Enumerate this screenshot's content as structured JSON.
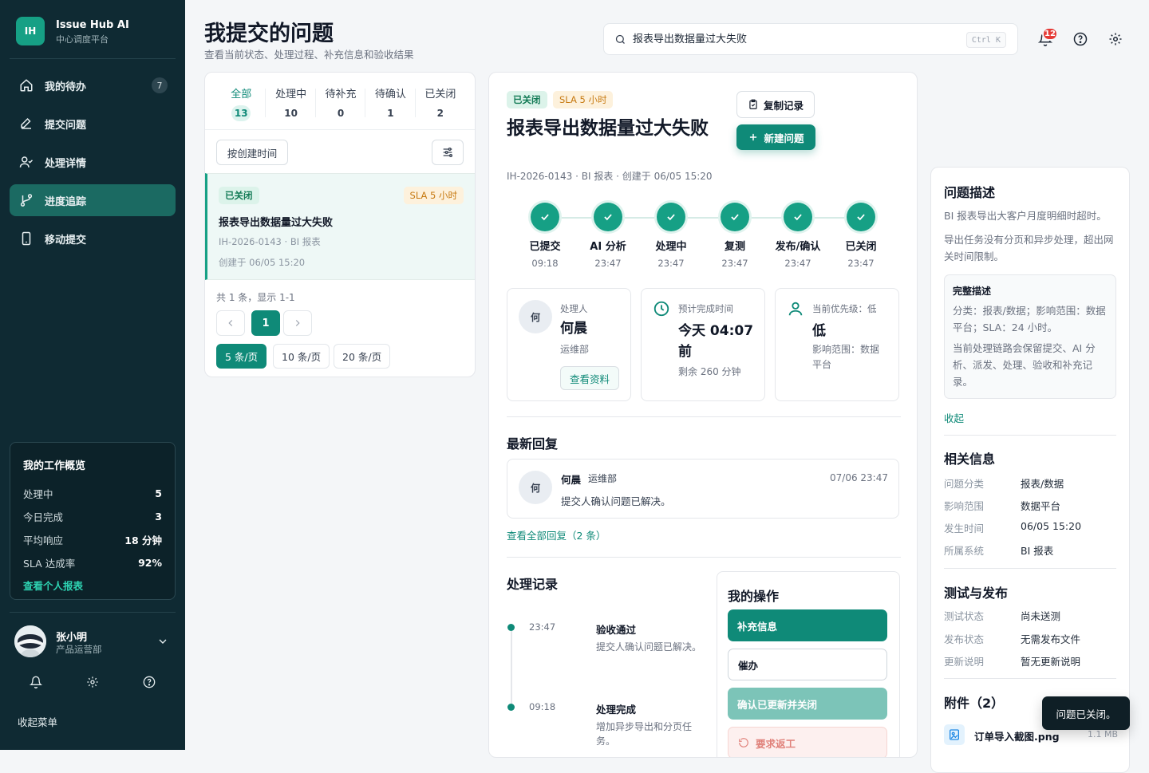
{
  "app": {
    "logo": "IH",
    "name": "Issue Hub AI",
    "subtitle": "中心调度平台"
  },
  "nav": [
    {
      "label": "我的待办",
      "icon": "home-icon",
      "count": "7"
    },
    {
      "label": "提交问题",
      "icon": "edit-icon"
    },
    {
      "label": "处理详情",
      "icon": "user-check-icon"
    },
    {
      "label": "进度追踪",
      "icon": "git-branch-icon",
      "active": true
    },
    {
      "label": "移动提交",
      "icon": "smartphone-icon"
    }
  ],
  "overview": {
    "title": "我的工作概览",
    "rows": [
      {
        "label": "处理中",
        "value": "5"
      },
      {
        "label": "今日完成",
        "value": "3"
      },
      {
        "label": "平均响应",
        "value": "18 分钟"
      },
      {
        "label": "SLA 达成率",
        "value": "92%"
      }
    ],
    "link": "查看个人报表"
  },
  "user": {
    "name": "张小明",
    "dept": "产品运营部"
  },
  "sidebar_footer": {
    "collapse": "收起菜单"
  },
  "header": {
    "title": "我提交的问题",
    "subtitle": "查看当前状态、处理过程、补充信息和验收结果"
  },
  "search": {
    "value": "报表导出数据量过大失败",
    "shortcut": "Ctrl K"
  },
  "notifications": {
    "count": "12"
  },
  "tabs": [
    {
      "label": "全部",
      "count": "13",
      "active": true
    },
    {
      "label": "处理中",
      "count": "10"
    },
    {
      "label": "待补充",
      "count": "0"
    },
    {
      "label": "待确认",
      "count": "1"
    },
    {
      "label": "已关闭",
      "count": "2"
    }
  ],
  "list": {
    "sort_label": "按创建时间",
    "item": {
      "status": "已关闭",
      "sla": "SLA 5 小时",
      "title": "报表导出数据量过大失败",
      "meta": "IH-2026-0143 · BI 报表",
      "created": "创建于 06/05 15:20"
    },
    "summary": "共 1 条，显示 1-1",
    "page": "1",
    "sizes": [
      "5 条/页",
      "10 条/页",
      "20 条/页"
    ]
  },
  "detail": {
    "status": "已关闭",
    "sla": "SLA 5 小时",
    "title": "报表导出数据量过大失败",
    "meta": "IH-2026-0143 · BI 报表 · 创建于 06/05 15:20",
    "copy_label": "复制记录",
    "new_label": "新建问题",
    "steps": [
      {
        "label": "已提交",
        "time": "09:18"
      },
      {
        "label": "AI 分析",
        "time": "23:47"
      },
      {
        "label": "处理中",
        "time": "23:47"
      },
      {
        "label": "复测",
        "time": "23:47"
      },
      {
        "label": "发布/确认",
        "time": "23:47"
      },
      {
        "label": "已关闭",
        "time": "23:47"
      }
    ],
    "assignee": {
      "avatar": "何",
      "label": "处理人",
      "name": "何晨",
      "dept": "运维部",
      "button": "查看资料"
    },
    "eta": {
      "label": "预计完成时间",
      "value_line1": "今天 04:07",
      "value_line2": "前",
      "remaining": "剩余 260 分钟"
    },
    "priority": {
      "label": "当前优先级：低",
      "value": "低",
      "scope_line1": "影响范围：数据",
      "scope_line2": "平台"
    },
    "latest_reply": {
      "title": "最新回复",
      "avatar": "何",
      "name": "何晨",
      "dept": "运维部",
      "time": "07/06 23:47",
      "text": "提交人确认问题已解决。",
      "view_all": "查看全部回复（2 条）"
    },
    "records": {
      "title": "处理记录",
      "items": [
        {
          "time": "23:47",
          "title": "验收通过",
          "desc": "提交人确认问题已解决。"
        },
        {
          "time": "09:18",
          "title": "处理完成",
          "desc": "增加异步导出和分页任务。"
        }
      ]
    },
    "ops": {
      "title": "我的操作",
      "buttons": [
        "补充信息",
        "催办",
        "确认已更新并关闭",
        "要求返工"
      ]
    }
  },
  "side": {
    "desc_title": "问题描述",
    "desc1": "BI 报表导出大客户月度明细时超时。",
    "desc2": "导出任务没有分页和异步处理，超出网关时间限制。",
    "full_title": "完整描述",
    "full1": "分类：报表/数据；影响范围：数据平台；SLA：24 小时。",
    "full2": "当前处理链路会保留提交、AI 分析、派发、处理、验收和补充记录。",
    "collapse": "收起",
    "related_title": "相关信息",
    "related": [
      {
        "k": "问题分类",
        "v": "报表/数据"
      },
      {
        "k": "影响范围",
        "v": "数据平台"
      },
      {
        "k": "发生时间",
        "v": "06/05 15:20"
      },
      {
        "k": "所属系统",
        "v": "BI 报表"
      }
    ],
    "release_title": "测试与发布",
    "release": [
      {
        "k": "测试状态",
        "v": "尚未送测"
      },
      {
        "k": "发布状态",
        "v": "无需发布文件"
      },
      {
        "k": "更新说明",
        "v": "暂无更新说明"
      }
    ],
    "attach_title": "附件（2）",
    "attach": {
      "name": "订单导入截图.png",
      "size": "1.1 MB"
    }
  },
  "toast": "问题已关闭。",
  "colors": {
    "primary": "#0f8a78",
    "sidebar": "#0f2a33",
    "active_nav": "#1b6a62",
    "accent": "#16a085"
  }
}
